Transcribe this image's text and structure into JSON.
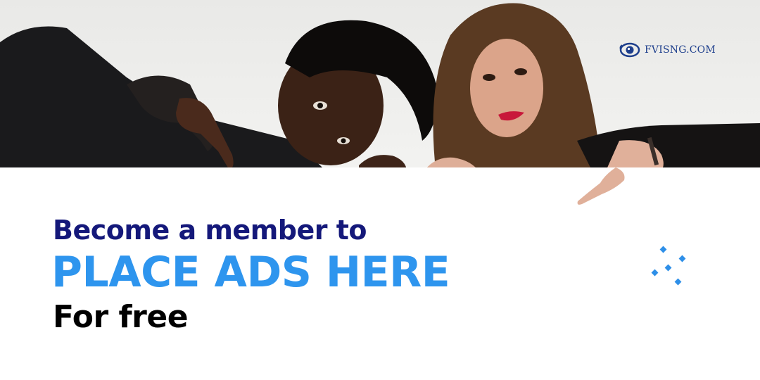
{
  "logo": {
    "text": "FVISNG.COM",
    "icon": "eye-logo-icon",
    "color": "#1d3e8c"
  },
  "headline": {
    "line1": "Become a member to",
    "line2": "PLACE ADS HERE",
    "line3": "For free"
  },
  "colors": {
    "navy": "#14187a",
    "blue": "#2e95ee",
    "black": "#000000"
  },
  "decoration": "diamond-dots-icon"
}
